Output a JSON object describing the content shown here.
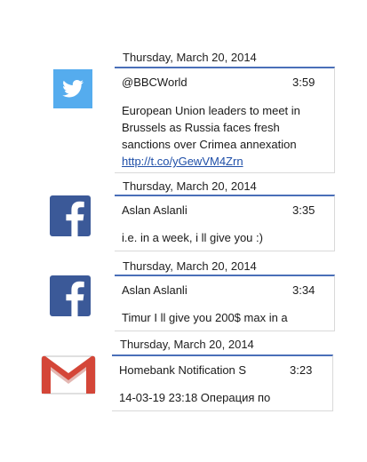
{
  "notifications": [
    {
      "app": "twitter",
      "icon": "twitter-bird-icon",
      "date": "Thursday, March 20, 2014",
      "from": "@BBCWorld",
      "time": "3:59",
      "body_lines": [
        "European Union leaders to meet in",
        "Brussels as Russia faces fresh",
        "sanctions over Crimea annexation"
      ],
      "link": "http://t.co/yGewVM4Zrn"
    },
    {
      "app": "facebook",
      "icon": "facebook-f-icon",
      "date": "Thursday, March 20, 2014",
      "from": "Aslan Aslanli",
      "time": "3:35",
      "body": "i.e. in a week, i ll give you :)"
    },
    {
      "app": "facebook",
      "icon": "facebook-f-icon",
      "date": "Thursday, March 20, 2014",
      "from": "Aslan Aslanli",
      "time": "3:34",
      "body": "Timur I ll give you 200$  max in a"
    },
    {
      "app": "gmail",
      "icon": "gmail-envelope-icon",
      "date": "Thursday, March 20, 2014",
      "from": "Homebank Notification  S",
      "time": "3:23",
      "body": "14-03-19 23:18 Операция по"
    }
  ],
  "colors": {
    "twitter": "#55acee",
    "facebook": "#3b5998",
    "gmail_red": "#d44638",
    "accent_line": "#4a6fb8"
  }
}
